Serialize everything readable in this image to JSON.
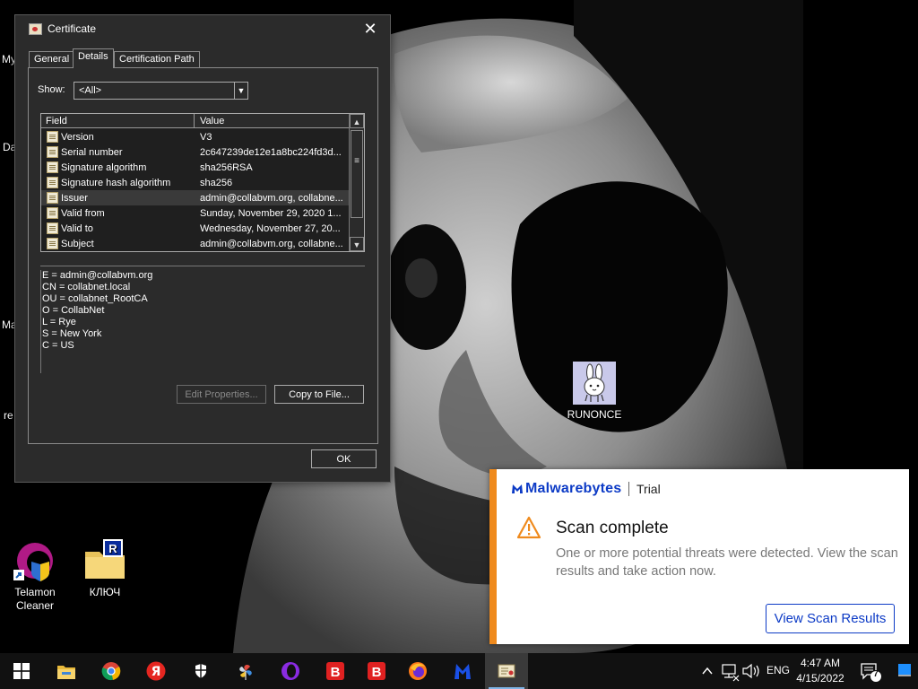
{
  "desktop": {
    "edge_labels": [
      "My",
      "Da",
      "Ma",
      "re"
    ],
    "icons": [
      {
        "id": "telamon",
        "label": "Telamon Cleaner"
      },
      {
        "id": "kluch",
        "label": "КЛЮЧ"
      },
      {
        "id": "runonce",
        "label": "RUNONCE"
      }
    ]
  },
  "cert_dialog": {
    "title": "Certificate",
    "close_glyph": "✕",
    "tabs": [
      {
        "label": "General",
        "active": false
      },
      {
        "label": "Details",
        "active": true
      },
      {
        "label": "Certification Path",
        "active": false
      }
    ],
    "show_label": "Show:",
    "show_value": "<All>",
    "columns": {
      "field": "Field",
      "value": "Value"
    },
    "rows": [
      {
        "field": "Version",
        "value": "V3",
        "selected": false
      },
      {
        "field": "Serial number",
        "value": "2c647239de12e1a8bc224fd3d...",
        "selected": false
      },
      {
        "field": "Signature algorithm",
        "value": "sha256RSA",
        "selected": false
      },
      {
        "field": "Signature hash algorithm",
        "value": "sha256",
        "selected": false
      },
      {
        "field": "Issuer",
        "value": "admin@collabvm.org, collabne...",
        "selected": true
      },
      {
        "field": "Valid from",
        "value": "Sunday, November 29, 2020 1...",
        "selected": false
      },
      {
        "field": "Valid to",
        "value": "Wednesday, November 27, 20...",
        "selected": false
      },
      {
        "field": "Subject",
        "value": "admin@collabvm.org, collabne...",
        "selected": false
      }
    ],
    "details": [
      "E = admin@collabvm.org",
      "CN = collabnet.local",
      "OU = collabnet_RootCA",
      "O = CollabNet",
      "L = Rye",
      "S = New York",
      "C = US"
    ],
    "edit_properties_label": "Edit Properties...",
    "copy_to_file_label": "Copy to File...",
    "ok_label": "OK"
  },
  "toast": {
    "brand": "Malwarebytes",
    "edition": "Trial",
    "title": "Scan complete",
    "message": "One or more potential threats were detected. View the scan results and take action now.",
    "action_label": "View Scan Results",
    "accent_color": "#ef8a1d",
    "brand_color": "#0d3bc6"
  },
  "taskbar": {
    "apps": [
      {
        "name": "file-explorer-icon"
      },
      {
        "name": "chrome-icon"
      },
      {
        "name": "yandex-browser-icon"
      },
      {
        "name": "security-shield-icon"
      },
      {
        "name": "pinwheel-app-icon"
      },
      {
        "name": "opera-icon"
      },
      {
        "name": "brave-red-b-icon"
      },
      {
        "name": "brave-red-b-icon-2"
      },
      {
        "name": "firefox-icon"
      },
      {
        "name": "malwarebytes-icon"
      },
      {
        "name": "certificate-icon"
      }
    ],
    "language": "ENG",
    "time": "4:47 AM",
    "date": "4/15/2022",
    "notification_count": "7"
  }
}
